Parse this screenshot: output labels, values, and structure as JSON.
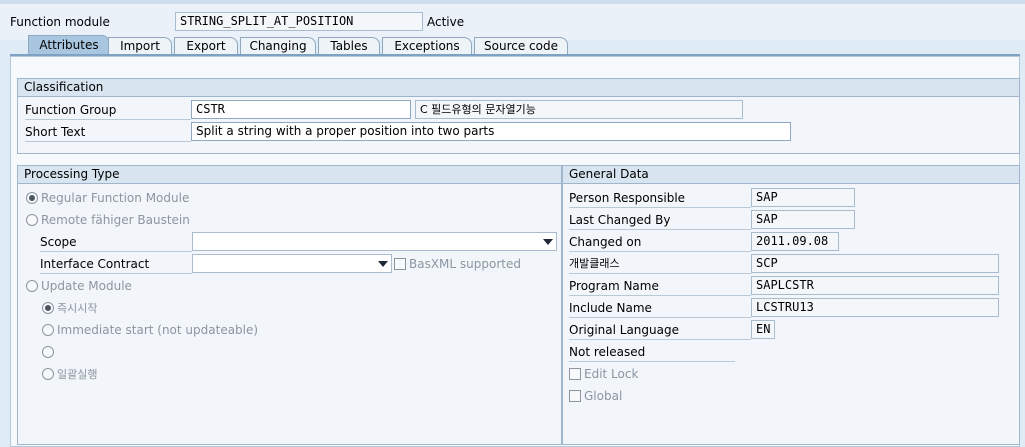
{
  "header": {
    "function_module_label": "Function module",
    "function_module_value": "STRING_SPLIT_AT_POSITION",
    "status": "Active"
  },
  "tabs": [
    {
      "label": "Attributes",
      "active": true
    },
    {
      "label": "Import"
    },
    {
      "label": "Export"
    },
    {
      "label": "Changing"
    },
    {
      "label": "Tables"
    },
    {
      "label": "Exceptions"
    },
    {
      "label": "Source code"
    }
  ],
  "classification": {
    "title": "Classification",
    "function_group_label": "Function Group",
    "function_group_value": "CSTR",
    "function_group_desc": "C 필드유형의 문자열기능",
    "short_text_label": "Short Text",
    "short_text_value": "Split a string with a proper position into two parts"
  },
  "processing": {
    "title": "Processing Type",
    "regular": "Regular Function Module",
    "remote": "Remote fähiger Baustein",
    "scope_label": "Scope",
    "scope_value": "",
    "interface_label": "Interface Contract",
    "interface_value": "",
    "basxml": "BasXML supported",
    "update": "Update Module",
    "update_opt1": "즉시시작",
    "update_opt2": "Immediate start (not updateable)",
    "update_opt3": "",
    "update_opt4": "일괄실행"
  },
  "general": {
    "title": "General Data",
    "person_label": "Person Responsible",
    "person_value": "SAP",
    "changed_by_label": "Last Changed By",
    "changed_by_value": "SAP",
    "changed_on_label": "Changed on",
    "changed_on_value": "2011.09.08",
    "devclass_label": "개발클래스",
    "devclass_value": "SCP",
    "program_label": "Program Name",
    "program_value": "SAPLCSTR",
    "include_label": "Include Name",
    "include_value": "LCSTRU13",
    "language_label": "Original Language",
    "language_value": "EN",
    "not_released": "Not released",
    "edit_lock": "Edit Lock",
    "global": "Global"
  }
}
